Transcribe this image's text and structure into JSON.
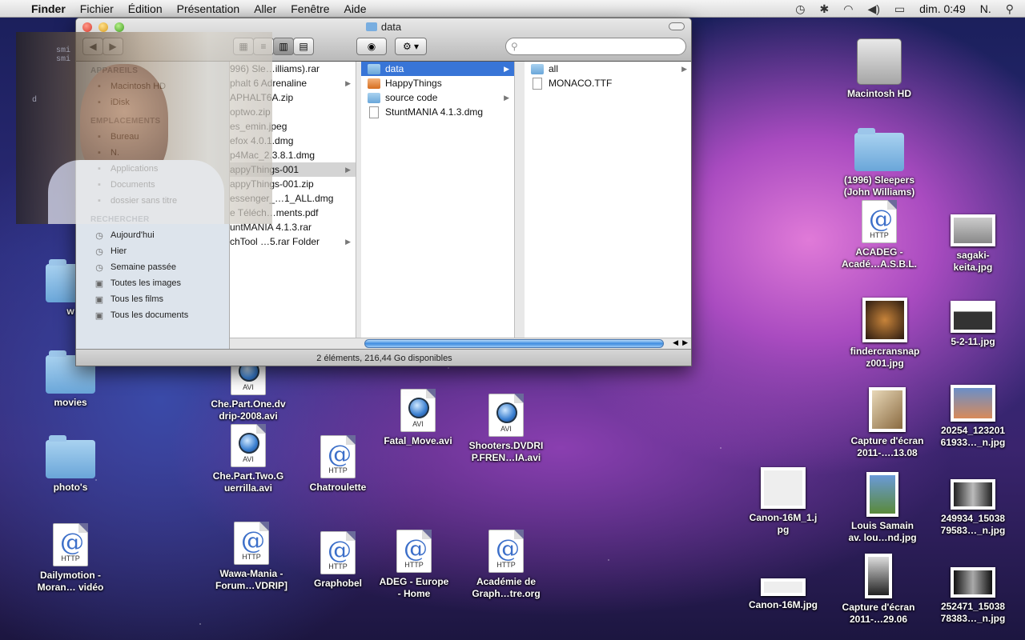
{
  "menubar": {
    "app": "Finder",
    "items": [
      "Fichier",
      "Édition",
      "Présentation",
      "Aller",
      "Fenêtre",
      "Aide"
    ],
    "clock": "dim. 0:49",
    "user": "N."
  },
  "finder": {
    "title": "data",
    "status": "2 éléments, 216,44 Go disponibles",
    "sidebar": {
      "sections": [
        {
          "title": "APPAREILS",
          "items": [
            {
              "label": "Macintosh HD",
              "icon": "hd-icon"
            },
            {
              "label": "iDisk",
              "icon": "idisk-icon"
            }
          ]
        },
        {
          "title": "EMPLACEMENTS",
          "items": [
            {
              "label": "Bureau",
              "icon": "desktop-icon"
            },
            {
              "label": "N.",
              "icon": "home-icon"
            },
            {
              "label": "Applications",
              "icon": "applications-icon"
            },
            {
              "label": "Documents",
              "icon": "documents-icon"
            },
            {
              "label": "dossier sans titre",
              "icon": "folder-icon"
            }
          ]
        },
        {
          "title": "RECHERCHER",
          "items": [
            {
              "label": "Aujourd'hui",
              "icon": "clock-icon"
            },
            {
              "label": "Hier",
              "icon": "clock-icon"
            },
            {
              "label": "Semaine passée",
              "icon": "clock-icon"
            },
            {
              "label": "Toutes les images",
              "icon": "smart-folder-icon"
            },
            {
              "label": "Tous les films",
              "icon": "smart-folder-icon"
            },
            {
              "label": "Tous les documents",
              "icon": "smart-folder-icon"
            }
          ]
        }
      ]
    },
    "col1": [
      {
        "label": "996) Sle…illiams).rar",
        "type": "file"
      },
      {
        "label": "phalt 6 Adrenaline",
        "type": "folder",
        "arrow": true
      },
      {
        "label": "APHALT6A.zip",
        "type": "file"
      },
      {
        "label": "optwo.zip",
        "type": "file"
      },
      {
        "label": "es_emin.jpeg",
        "type": "file"
      },
      {
        "label": "efox 4.0.1.dmg",
        "type": "file"
      },
      {
        "label": "p4Mac_2.3.8.1.dmg",
        "type": "file"
      },
      {
        "label": "appyThings-001",
        "type": "folder",
        "arrow": true,
        "dim": true
      },
      {
        "label": "appyThings-001.zip",
        "type": "file"
      },
      {
        "label": "essenger_…1_ALL.dmg",
        "type": "file"
      },
      {
        "label": "e Téléch…ments.pdf",
        "type": "file"
      },
      {
        "label": "untMANIA 4.1.3.rar",
        "type": "file"
      },
      {
        "label": "chTool …5.rar Folder",
        "type": "folder",
        "arrow": true
      }
    ],
    "col2": [
      {
        "label": "data",
        "type": "folder",
        "arrow": true,
        "selected": true
      },
      {
        "label": "HappyThings",
        "type": "app"
      },
      {
        "label": "source code",
        "type": "folder",
        "arrow": true
      },
      {
        "label": "StuntMANIA 4.1.3.dmg",
        "type": "file"
      }
    ],
    "col3": [
      {
        "label": "all",
        "type": "folder",
        "arrow": true
      },
      {
        "label": "MONACO.TTF",
        "type": "file"
      }
    ]
  },
  "webcam": {
    "lines": [
      "smi",
      "smi",
      "d"
    ]
  },
  "desktop": {
    "icons": [
      {
        "id": "macintosh-hd",
        "label": "Macintosh HD",
        "kind": "hd"
      },
      {
        "id": "sleepers",
        "label": "(1996) Sleepers\n(John Williams)",
        "kind": "folder"
      },
      {
        "id": "acadeg",
        "label": "ACADEG -\nAcadé…A.S.B.L.",
        "kind": "http"
      },
      {
        "id": "sagaki",
        "label": "sagaki-\nkeita.jpg",
        "kind": "photo"
      },
      {
        "id": "findercransnap",
        "label": "findercransnap\nz001.jpg",
        "kind": "photo"
      },
      {
        "id": "five-2-11",
        "label": "5-2-11.jpg",
        "kind": "photo"
      },
      {
        "id": "capture-1308",
        "label": "Capture d'écran\n2011-….13.08",
        "kind": "photo"
      },
      {
        "id": "p20254",
        "label": "20254_123201\n61933…_n.jpg",
        "kind": "photo"
      },
      {
        "id": "canon16m1",
        "label": "Canon-16M_1.j\npg",
        "kind": "photo"
      },
      {
        "id": "louis",
        "label": "Louis Samain\nav. lou…nd.jpg",
        "kind": "photo"
      },
      {
        "id": "p249934",
        "label": "249934_15038\n79583…_n.jpg",
        "kind": "photo"
      },
      {
        "id": "canon16m",
        "label": "Canon-16M.jpg",
        "kind": "photo"
      },
      {
        "id": "capture-2906",
        "label": "Capture d'écran\n2011-…29.06",
        "kind": "photo"
      },
      {
        "id": "p252471",
        "label": "252471_15038\n78383…_n.jpg",
        "kind": "photo"
      },
      {
        "id": "w",
        "label": "w",
        "kind": "folder"
      },
      {
        "id": "movies",
        "label": "movies",
        "kind": "folder"
      },
      {
        "id": "photos",
        "label": "photo's",
        "kind": "folder"
      },
      {
        "id": "dailymotion",
        "label": "Dailymotion -\nMoran… vidéo",
        "kind": "http"
      },
      {
        "id": "che1",
        "label": "Che.Part.One.dv\ndrip-2008.avi",
        "kind": "avi"
      },
      {
        "id": "che2",
        "label": "Che.Part.Two.G\nuerrilla.avi",
        "kind": "avi"
      },
      {
        "id": "chatroulette",
        "label": "Chatroulette",
        "kind": "http"
      },
      {
        "id": "fatal",
        "label": "Fatal_Move.avi",
        "kind": "avi"
      },
      {
        "id": "shooters",
        "label": "Shooters.DVDRI\nP.FREN…IA.avi",
        "kind": "avi"
      },
      {
        "id": "wawa",
        "label": "Wawa-Mania -\nForum…VDRIP]",
        "kind": "http"
      },
      {
        "id": "graphobel",
        "label": "Graphobel",
        "kind": "http"
      },
      {
        "id": "adeg",
        "label": "ADEG - Europe\n- Home",
        "kind": "http"
      },
      {
        "id": "academie",
        "label": "Académie de\nGraph…tre.org",
        "kind": "http"
      }
    ],
    "avi_text": "AVI",
    "http_text": "HTTP"
  }
}
